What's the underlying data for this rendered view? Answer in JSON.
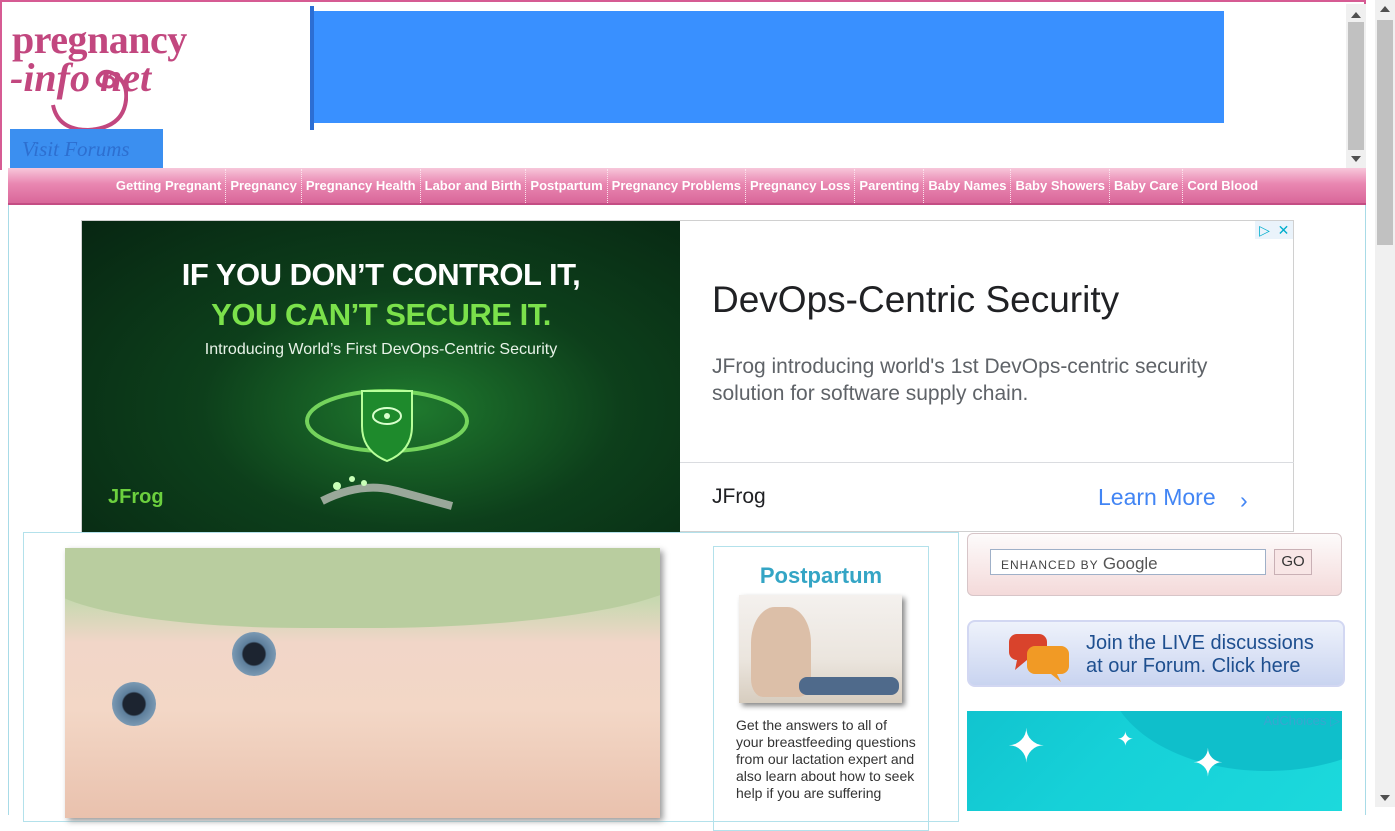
{
  "header": {
    "logo_line1": "pregnancy",
    "logo_line2": "-info   net",
    "visit_forums": "Visit Forums",
    "banner_color": "#3990ff"
  },
  "nav": {
    "items": [
      "Getting Pregnant",
      "Pregnancy",
      "Pregnancy Health",
      "Labor and Birth",
      "Postpartum",
      "Pregnancy Problems",
      "Pregnancy Loss",
      "Parenting",
      "Baby Names",
      "Baby Showers",
      "Baby Care",
      "Cord Blood"
    ]
  },
  "big_ad": {
    "image_headline_1": "IF YOU DON’T CONTROL IT,",
    "image_headline_2": "YOU CAN’T SECURE IT.",
    "image_subline": "Introducing World’s First DevOps-Centric Security",
    "image_brand": "JFrog",
    "title": "DevOps-Centric Security",
    "description": "JFrog introducing world's 1st DevOps-centric security solution for software supply chain.",
    "advertiser": "JFrog",
    "cta": "Learn More",
    "cta_icon": "chevron-right-icon",
    "adchoices_icon": "adchoices-icon",
    "close_icon": "close-icon"
  },
  "article": {
    "postpartum_title": "Postpartum",
    "postpartum_text": "Get the answers to all of your breastfeeding questions from our lactation expert and also learn about how to seek help if you are suffering"
  },
  "sidebar": {
    "search_label": "ENHANCED BY",
    "search_brand": "Google",
    "search_button": "GO",
    "forum_banner": "Join the LIVE discussions at our Forum. Click here",
    "side_ad_choices": "AdChoices"
  },
  "colors": {
    "brand_pink": "#c2477f",
    "nav_pink": "#e987b1",
    "accent_teal": "#34a5c5",
    "ad_blue": "#4285f4"
  }
}
